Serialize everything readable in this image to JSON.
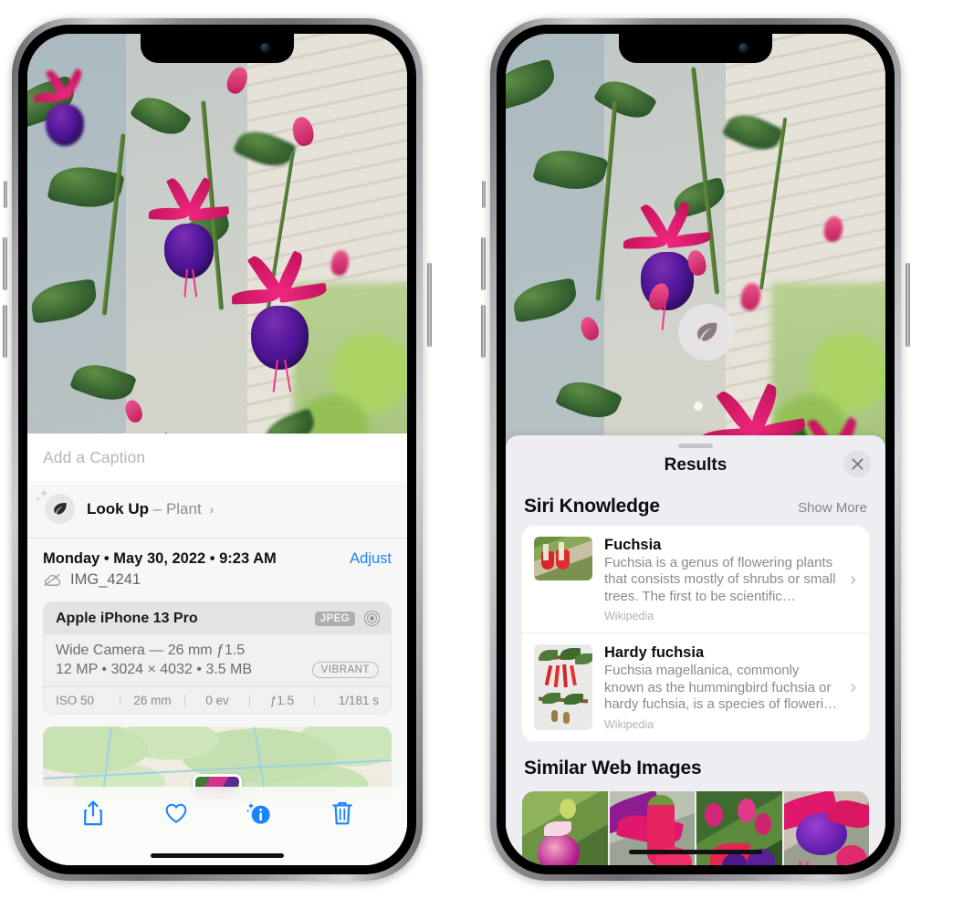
{
  "left_phone": {
    "caption_placeholder": "Add a Caption",
    "lookup": {
      "icon": "leaf-icon",
      "label": "Look Up",
      "dash": "–",
      "subject": "Plant",
      "chevron": "›"
    },
    "date": "Monday • May 30, 2022 • 9:23 AM",
    "adjust_label": "Adjust",
    "file_name": "IMG_4241",
    "cloud_icon": "icloud-slash-icon",
    "metadata": {
      "device": "Apple iPhone 13 Pro",
      "format_badge": "JPEG",
      "hdr_icon": "hdr-target-icon",
      "lens_line": "Wide Camera — 26 mm ƒ1.5",
      "specs_line": "12 MP • 3024 × 4032 • 3.5 MB",
      "style_badge": "VIBRANT",
      "exif": [
        "ISO 50",
        "26 mm",
        "0 ev",
        "ƒ1.5",
        "1/181 s"
      ]
    },
    "toolbar": [
      {
        "name": "share-button",
        "icon": "share-icon"
      },
      {
        "name": "favorite-button",
        "icon": "heart-icon"
      },
      {
        "name": "info-button",
        "icon": "info-sparkle-icon"
      },
      {
        "name": "delete-button",
        "icon": "trash-icon"
      }
    ]
  },
  "right_phone": {
    "visual_lookup_badge": {
      "icon": "leaf-icon"
    },
    "sheet_title": "Results",
    "close_icon": "close-icon",
    "sections": [
      {
        "title": "Siri Knowledge",
        "action_label": "Show More",
        "cards": [
          {
            "title": "Fuchsia",
            "description": "Fuchsia is a genus of flowering plants that consists mostly of shrubs or small trees. The first to be scientific…",
            "source": "Wikipedia",
            "chevron": "›",
            "thumb": "landscape"
          },
          {
            "title": "Hardy fuchsia",
            "description": "Fuchsia magellanica, commonly known as the hummingbird fuchsia or hardy fuchsia, is a species of floweri…",
            "source": "Wikipedia",
            "chevron": "›",
            "thumb": "portrait"
          }
        ]
      },
      {
        "title": "Similar Web Images",
        "images_count": 4
      }
    ]
  },
  "colors": {
    "accent_blue": "#1a84ff",
    "sheet_background": "#eeedf2",
    "card_white": "#ffffff",
    "secondary_text": "#8a8a8e",
    "flower_pink": "#e8217c",
    "flower_purple": "#4f1794"
  }
}
